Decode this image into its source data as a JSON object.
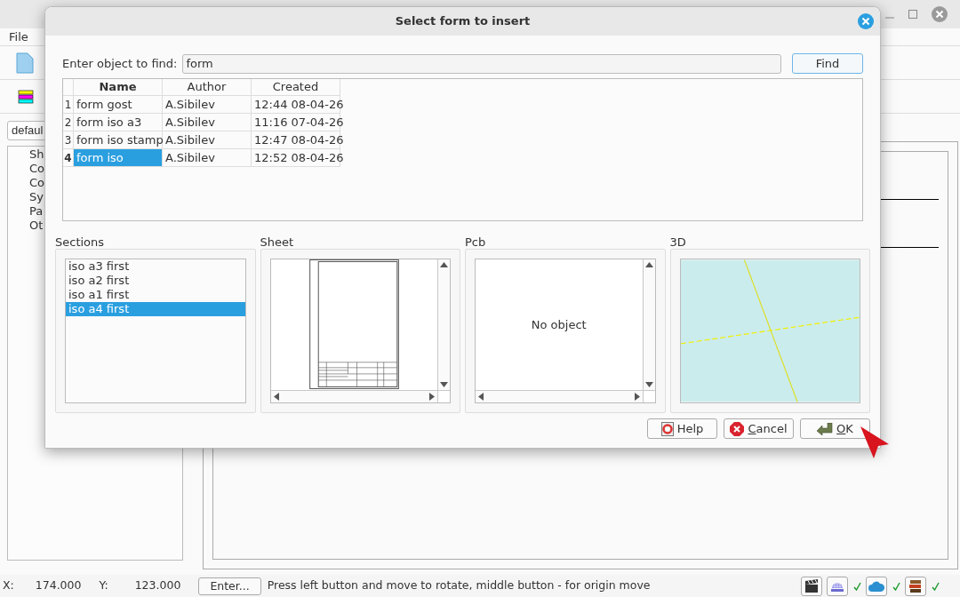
{
  "app": {
    "menu": [
      "File"
    ],
    "combo_value": "defaul",
    "tree_items": [
      "Sh",
      "Co",
      "Co",
      "Sy",
      "Pa",
      "Ot"
    ]
  },
  "dialog": {
    "title": "Select form to insert",
    "search": {
      "label": "Enter object to find:",
      "value": "form",
      "button": "Find"
    },
    "table": {
      "columns": [
        "Name",
        "Author",
        "Created"
      ],
      "rows": [
        {
          "number": "1",
          "name": "form gost",
          "author": "A.Sibilev",
          "created": "12:44 08-04-26",
          "selected": false
        },
        {
          "number": "2",
          "name": "form iso a3",
          "author": "A.Sibilev",
          "created": "11:16 07-04-26",
          "selected": false
        },
        {
          "number": "3",
          "name": "form iso stamp",
          "author": "A.Sibilev",
          "created": "12:47 08-04-26",
          "selected": false
        },
        {
          "number": "4",
          "name": "form iso",
          "author": "A.Sibilev",
          "created": "12:52 08-04-26",
          "selected": true
        }
      ]
    },
    "panels": {
      "sections": {
        "title": "Sections",
        "items": [
          {
            "label": "iso a3 first",
            "selected": false
          },
          {
            "label": "iso a2 first",
            "selected": false
          },
          {
            "label": "iso a1 first",
            "selected": false
          },
          {
            "label": "iso a4 first",
            "selected": true
          }
        ]
      },
      "sheet": {
        "title": "Sheet"
      },
      "pcb": {
        "title": "Pcb",
        "message": "No object"
      },
      "view3d": {
        "title": "3D"
      }
    },
    "buttons": [
      {
        "kind": "help",
        "label": "Help"
      },
      {
        "kind": "cancel",
        "label": "Cancel"
      },
      {
        "kind": "ok",
        "label": "OK"
      }
    ]
  },
  "status_bar": {
    "x_label": "X:",
    "x_value": "174.000",
    "y_label": "Y:",
    "y_value": "123.000",
    "enter_button": "Enter...",
    "message": "Press left button and move to rotate, middle button - for origin move",
    "indicators": [
      {
        "kind": "film",
        "ok": false
      },
      {
        "kind": "globe",
        "ok": true
      },
      {
        "kind": "cloud",
        "ok": true
      },
      {
        "kind": "books",
        "ok": true
      }
    ]
  }
}
